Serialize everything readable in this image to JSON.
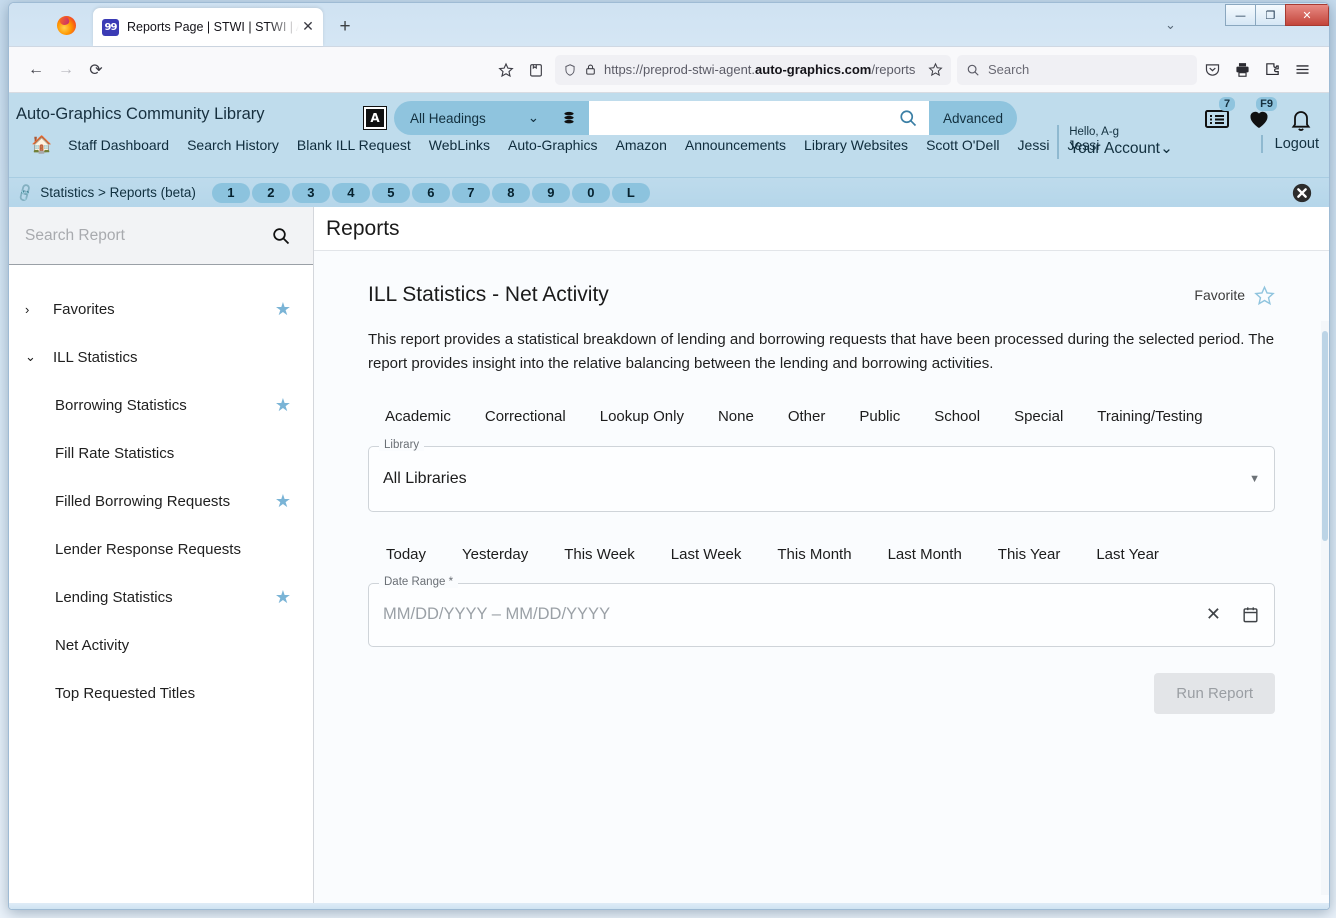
{
  "browser": {
    "tab_title": "Reports Page | STWI | STWI | Au",
    "tab_close_glyph": "✕",
    "new_tab_glyph": "+",
    "favicon_text": "99",
    "url_prefix": "https://preprod-stwi-agent.",
    "url_domain": "auto-graphics.com",
    "url_suffix": "/reports",
    "search_placeholder": "Search",
    "window_minimize": "—",
    "window_restore": "❐",
    "window_close": "✕",
    "back_glyph": "←",
    "forward_glyph": "→",
    "reload_glyph": "⟳"
  },
  "masthead": {
    "brand": "Auto-Graphics Community Library",
    "headings_select": "All Headings",
    "search_value": "",
    "advanced_label": "Advanced",
    "list_badge": "7",
    "heart_badge": "F9",
    "greeting": "Hello, A-g",
    "account_label": "Your Account",
    "account_caret": "⌄",
    "logout_label": "Logout",
    "accent_color": "#8fc4de",
    "header_bg": "#bfdcec"
  },
  "nav_links": [
    "Staff Dashboard",
    "Search History",
    "Blank ILL Request",
    "WebLinks",
    "Auto-Graphics",
    "Amazon",
    "Announcements",
    "Library Websites",
    "Scott O'Dell",
    "Jessi",
    "Jessi"
  ],
  "breadcrumb": {
    "text": "Statistics > Reports (beta)",
    "pills": [
      "1",
      "2",
      "3",
      "4",
      "5",
      "6",
      "7",
      "8",
      "9",
      "0",
      "L"
    ]
  },
  "sidebar": {
    "search_placeholder": "Search Report",
    "search_value": "",
    "items": [
      {
        "label": "Favorites",
        "level": "top",
        "chevron": "›",
        "starred": true
      },
      {
        "label": "ILL Statistics",
        "level": "top",
        "chevron": "⌄",
        "starred": false
      },
      {
        "label": "Borrowing Statistics",
        "level": "child",
        "chevron": "",
        "starred": true
      },
      {
        "label": "Fill Rate Statistics",
        "level": "child",
        "chevron": "",
        "starred": false
      },
      {
        "label": "Filled Borrowing Requests",
        "level": "child",
        "chevron": "",
        "starred": true
      },
      {
        "label": "Lender Response Requests",
        "level": "child",
        "chevron": "",
        "starred": false
      },
      {
        "label": "Lending Statistics",
        "level": "child",
        "chevron": "",
        "starred": true
      },
      {
        "label": "Net Activity",
        "level": "child",
        "chevron": "",
        "starred": false
      },
      {
        "label": "Top Requested Titles",
        "level": "child",
        "chevron": "",
        "starred": false
      }
    ]
  },
  "content": {
    "page_title": "Reports",
    "report_title": "ILL Statistics - Net Activity",
    "favorite_label": "Favorite",
    "favorite_star": "☆",
    "description": "This report provides a statistical breakdown of lending and borrowing requests that have been processed during the selected period. The report provides insight into the relative balancing between the lending and borrowing activities.",
    "library_type_tabs": [
      "Academic",
      "Correctional",
      "Lookup Only",
      "None",
      "Other",
      "Public",
      "School",
      "Special",
      "Training/Testing"
    ],
    "library_field": {
      "label": "Library",
      "value": "All Libraries"
    },
    "quick_ranges": [
      "Today",
      "Yesterday",
      "This Week",
      "Last Week",
      "This Month",
      "Last Month",
      "This Year",
      "Last Year"
    ],
    "date_range_field": {
      "label": "Date Range *",
      "placeholder": "MM/DD/YYYY – MM/DD/YYYY",
      "value": "",
      "clear_glyph": "✕"
    },
    "run_button": {
      "label": "Run Report",
      "disabled": true
    }
  }
}
